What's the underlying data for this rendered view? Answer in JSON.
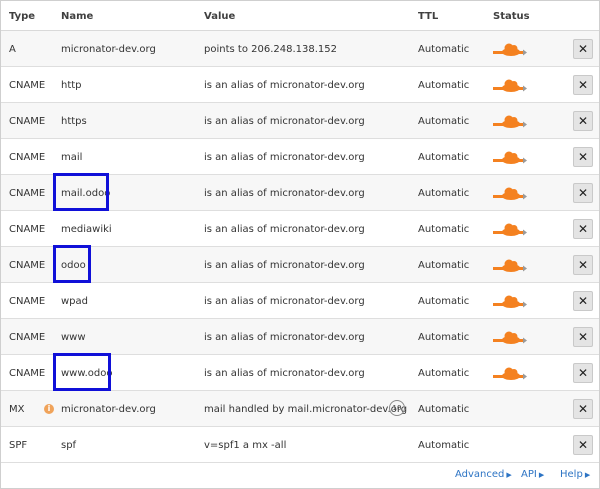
{
  "columns": {
    "type": "Type",
    "name": "Name",
    "value": "Value",
    "ttl": "TTL",
    "status": "Status"
  },
  "records": [
    {
      "type": "A",
      "name": "micronator-dev.org",
      "value": "points to 206.248.138.152",
      "ttl": "Automatic",
      "proxied": true
    },
    {
      "type": "CNAME",
      "name": "http",
      "value": "is an alias of micronator-dev.org",
      "ttl": "Automatic",
      "proxied": true
    },
    {
      "type": "CNAME",
      "name": "https",
      "value": "is an alias of micronator-dev.org",
      "ttl": "Automatic",
      "proxied": true
    },
    {
      "type": "CNAME",
      "name": "mail",
      "value": "is an alias of micronator-dev.org",
      "ttl": "Automatic",
      "proxied": true
    },
    {
      "type": "CNAME",
      "name": "mail.odoo",
      "value": "is an alias of micronator-dev.org",
      "ttl": "Automatic",
      "proxied": true,
      "highlighted": true
    },
    {
      "type": "CNAME",
      "name": "mediawiki",
      "value": "is an alias of micronator-dev.org",
      "ttl": "Automatic",
      "proxied": true
    },
    {
      "type": "CNAME",
      "name": "odoo",
      "value": "is an alias of micronator-dev.org",
      "ttl": "Automatic",
      "proxied": true,
      "highlighted": true
    },
    {
      "type": "CNAME",
      "name": "wpad",
      "value": "is an alias of micronator-dev.org",
      "ttl": "Automatic",
      "proxied": true
    },
    {
      "type": "CNAME",
      "name": "www",
      "value": "is an alias of micronator-dev.org",
      "ttl": "Automatic",
      "proxied": true
    },
    {
      "type": "CNAME",
      "name": "www.odoo",
      "value": "is an alias of micronator-dev.org",
      "ttl": "Automatic",
      "proxied": true,
      "highlighted": true
    },
    {
      "type": "MX",
      "name": "micronator-dev.org",
      "value": "mail handled by mail.micronator-dev.org",
      "ttl": "Automatic",
      "proxied": false,
      "info_icon": "i",
      "priority": "10"
    },
    {
      "type": "SPF",
      "name": "spf",
      "value": "v=spf1 a mx -all",
      "ttl": "Automatic",
      "proxied": false
    }
  ],
  "delete_label": "✕",
  "icons": {
    "status": "cloud-proxied-icon",
    "delete": "close-icon",
    "info": "info-icon"
  },
  "colors": {
    "cloud": "#f48120",
    "highlight": "#1010d8",
    "link": "#2d74c4"
  },
  "footer": {
    "advanced": "Advanced",
    "api": "API",
    "help": "Help"
  }
}
